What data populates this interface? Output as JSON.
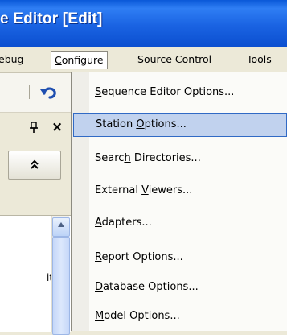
{
  "window": {
    "title": "e Editor [Edit]"
  },
  "menubar": {
    "items": [
      {
        "label": "ebug"
      },
      {
        "label": "Configure",
        "accel_prefix": "",
        "accel": "C",
        "accel_suffix": "onfigure"
      },
      {
        "label": "Source Control",
        "accel_prefix": "",
        "accel": "S",
        "accel_suffix": "ource Control"
      },
      {
        "label": "Tools",
        "accel_prefix": "",
        "accel": "T",
        "accel_suffix": "ools"
      }
    ]
  },
  "toolbar": {
    "undo_icon": "undo-icon"
  },
  "pane": {
    "pin_glyph": "⁠ꟷ",
    "pin_icon_text": "ᵖ",
    "close_glyph": "×",
    "collapse_glyph": "≈",
    "truncated_text": "it",
    "scroll_up_glyph": "▲"
  },
  "configure_menu": {
    "items": [
      {
        "pre": "",
        "accel": "S",
        "post": "equence Editor Options..."
      },
      {
        "pre": "Station ",
        "accel": "O",
        "post": "ptions...",
        "highlighted": true
      },
      {
        "pre": "Searc",
        "accel": "h",
        "post": " Directories..."
      },
      {
        "pre": "External ",
        "accel": "V",
        "post": "iewers..."
      },
      {
        "pre": "",
        "accel": "A",
        "post": "dapters..."
      },
      {
        "pre": "",
        "accel": "R",
        "post": "eport Options..."
      },
      {
        "pre": "",
        "accel": "D",
        "post": "atabase Options..."
      },
      {
        "pre": "",
        "accel": "M",
        "post": "odel Options..."
      }
    ]
  },
  "colors": {
    "title_bar": "#1a63e2",
    "menu_highlight": "#c1d2ee",
    "menu_highlight_border": "#316ac5"
  }
}
